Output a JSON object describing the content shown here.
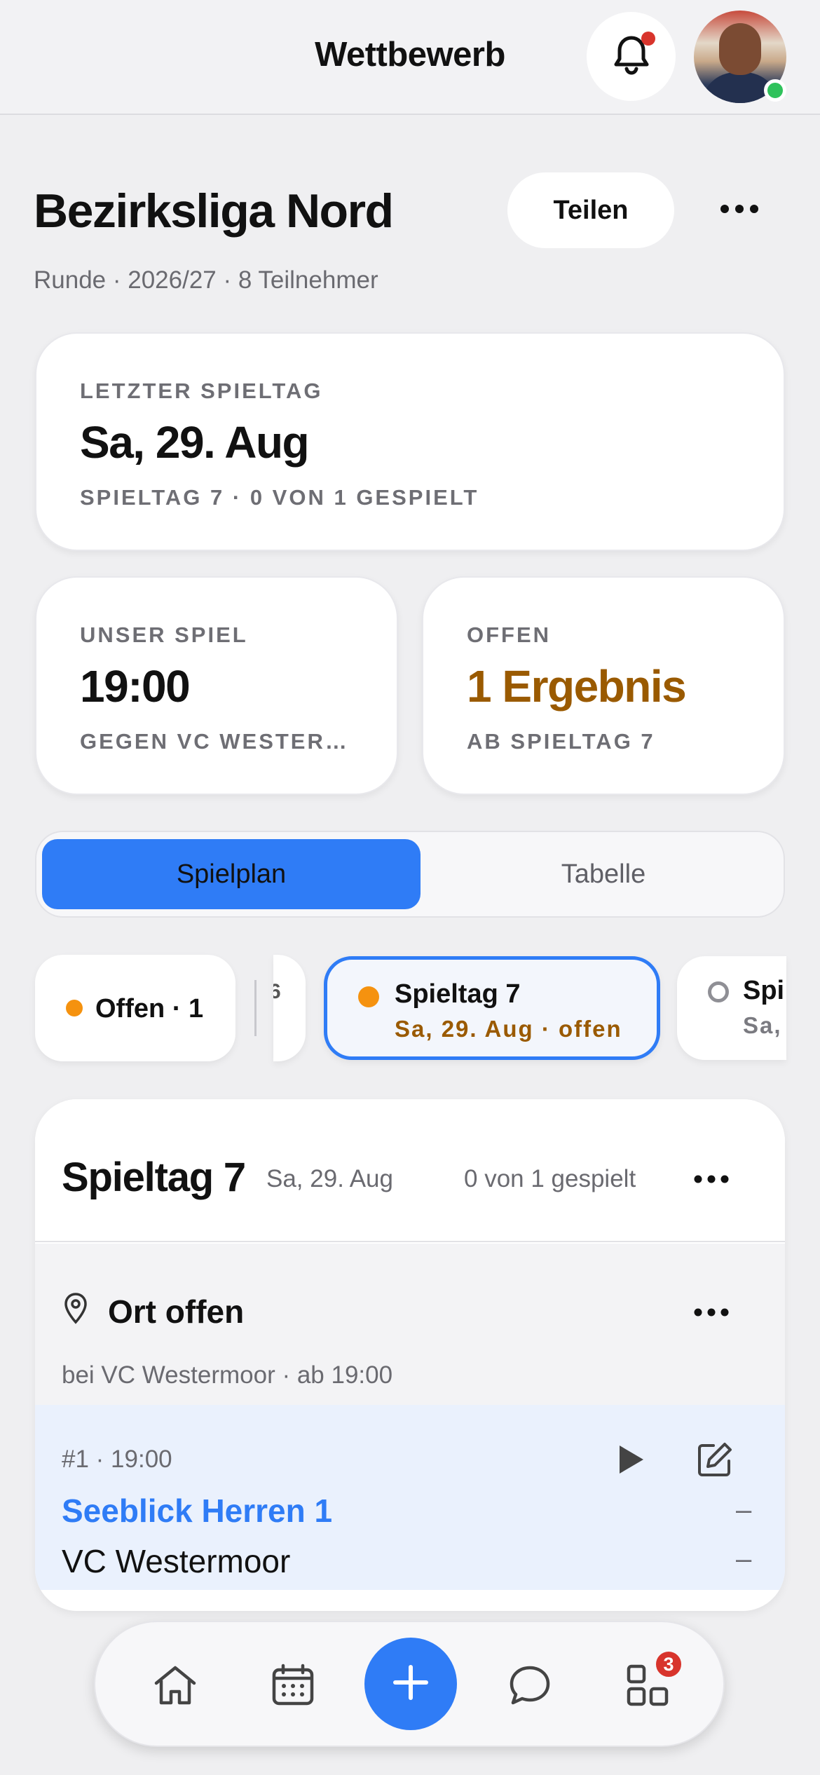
{
  "topbar": {
    "title": "Wettbewerb"
  },
  "header": {
    "title": "Bezirksliga Nord",
    "share_label": "Teilen",
    "subline": "Runde · 2026/27 · 8 Teilnehmer"
  },
  "cards": {
    "last_matchday": {
      "label": "LETZTER SPIELTAG",
      "value": "Sa, 29. Aug",
      "sub": "SPIELTAG 7 · 0 VON 1 GESPIELT"
    },
    "our_game": {
      "label": "UNSER SPIEL",
      "value": "19:00",
      "sub": "GEGEN VC WESTER…"
    },
    "open": {
      "label": "OFFEN",
      "value": "1 Ergebnis",
      "sub": "AB SPIELTAG 7"
    }
  },
  "segment": {
    "active": "Spielplan",
    "inactive": "Tabelle"
  },
  "chips": {
    "open": "Offen · 1",
    "partial_left": "6",
    "selected_title": "Spieltag 7",
    "selected_sub": "Sa, 29. Aug · offen",
    "next_title": "Spi",
    "next_sub": "Sa,"
  },
  "matchday": {
    "title": "Spieltag 7",
    "date": "Sa, 29. Aug",
    "count": "0 von 1 gespielt",
    "venue_title": "Ort offen",
    "venue_sub": "bei VC Westermoor · ab 19:00",
    "game_meta": "#1 · 19:00",
    "home_team": "Seeblick Herren 1",
    "away_team": "VC Westermoor",
    "home_score": "–",
    "away_score": "–"
  },
  "tabbar": {
    "badge_count": "3"
  },
  "colors": {
    "accent": "#2f7cf6",
    "warning": "#9a5a00",
    "orange_dot": "#f5920f",
    "notification": "#d8342c",
    "online": "#2fc25b"
  }
}
